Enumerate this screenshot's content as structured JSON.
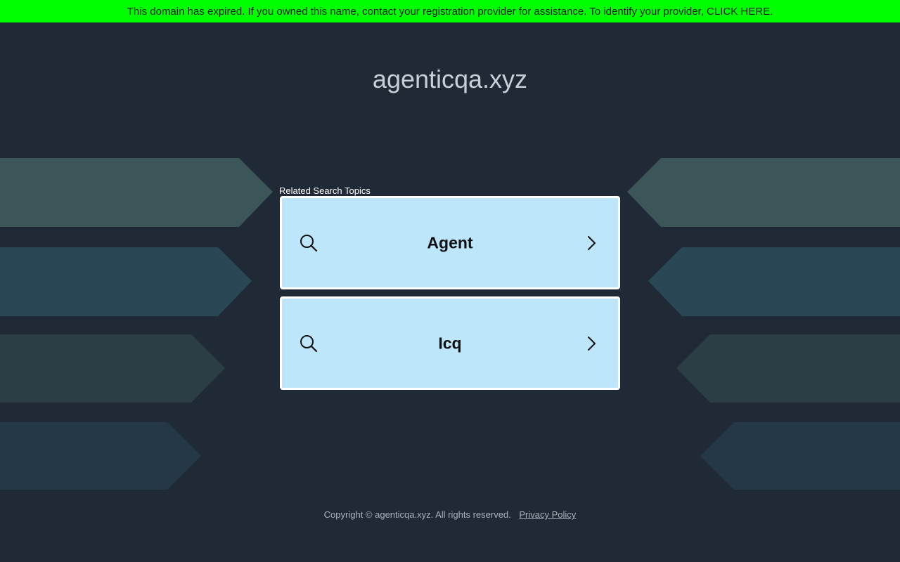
{
  "banner": {
    "text": "This domain has expired. If you owned this name, contact your registration provider for assistance. To identify your provider, CLICK HERE."
  },
  "domain": {
    "title": "agenticqa.xyz"
  },
  "related": {
    "label": "Related Search Topics",
    "topics": [
      {
        "label": "Agent"
      },
      {
        "label": "Icq"
      }
    ]
  },
  "footer": {
    "copyright": "Copyright © agenticqa.xyz.  All rights reserved.",
    "privacy_label": "Privacy Policy"
  },
  "colors": {
    "background": "#1f2a36",
    "banner": "#00ff00",
    "card_fill": "#bde6fb",
    "card_border": "#ffffff"
  },
  "icons": {
    "search": "search-icon",
    "chevron": "chevron-right-icon"
  }
}
